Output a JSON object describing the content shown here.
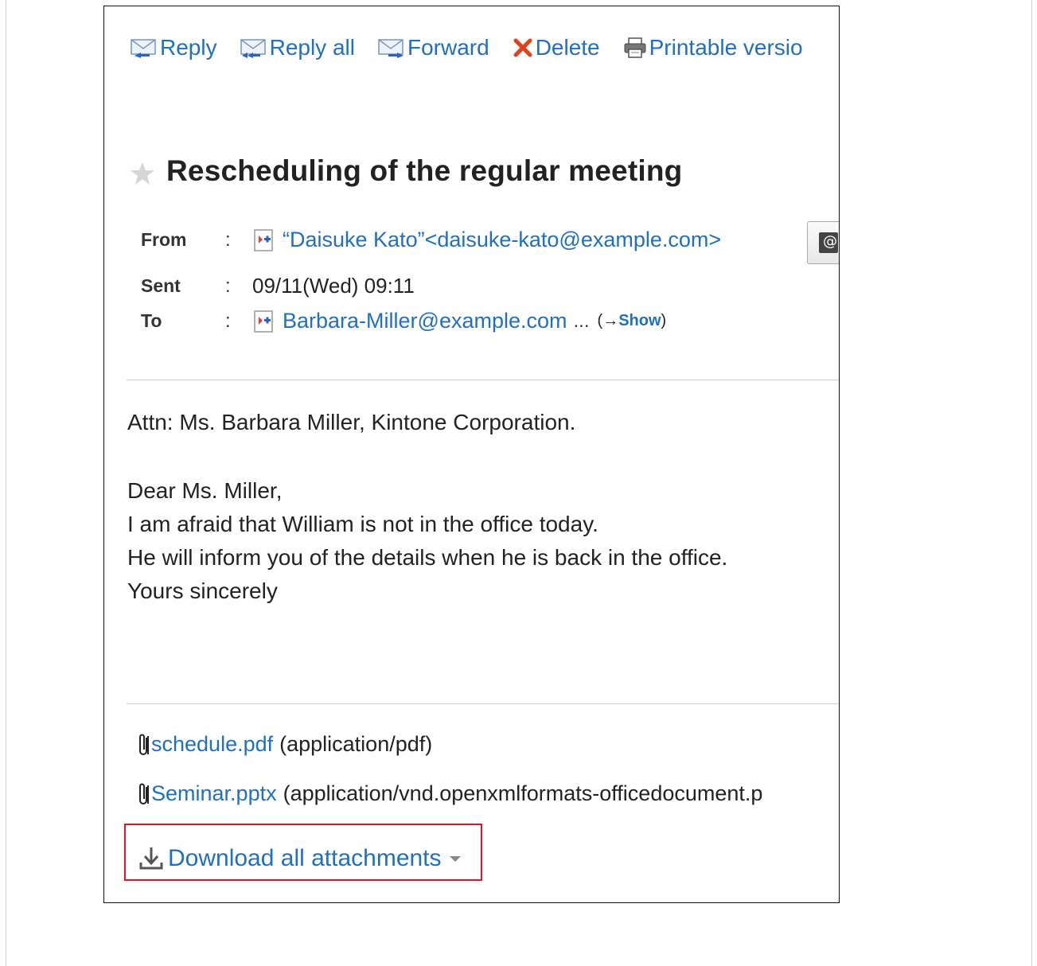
{
  "toolbar": {
    "reply": "Reply",
    "reply_all": "Reply all",
    "forward": "Forward",
    "delete": "Delete",
    "printable": "Printable versio"
  },
  "message": {
    "subject": "Rescheduling of the regular meeting",
    "from_label": "From",
    "from_value": "“Daisuke Kato”<daisuke-kato@example.com>",
    "sent_label": "Sent",
    "sent_value": "09/11(Wed) 09:11",
    "to_label": "To",
    "to_value": "Barbara-Miller@example.com",
    "to_more": "...",
    "show_prefix": "(→",
    "show_label": "Show",
    "show_suffix": ")",
    "colon": ":",
    "body_lines": [
      "Attn: Ms. Barbara Miller, Kintone Corporation.",
      "Dear Ms. Miller,",
      "I am afraid that William is not in the office today.",
      "He will inform you of the details when he is back in the office.",
      "Yours sincerely"
    ]
  },
  "attachments": [
    {
      "name": "schedule.pdf",
      "type": "(application/pdf)"
    },
    {
      "name": "Seminar.pptx",
      "type": "(application/vnd.openxmlformats-officedocument.p"
    }
  ],
  "download_all": "Download all attachments",
  "colors": {
    "link": "#1f6fc2",
    "delete_x": "#e0401a",
    "highlight_box": "#e0141e"
  }
}
